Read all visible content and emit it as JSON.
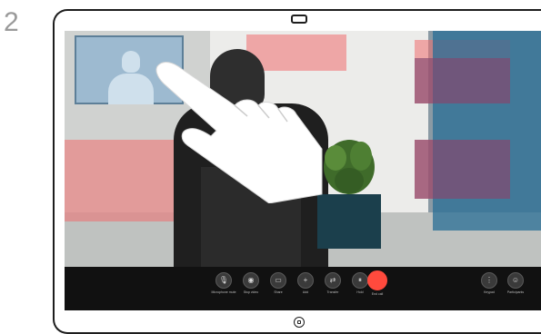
{
  "step_number": "2",
  "colors": {
    "end_call": "#ff4a3d",
    "control_bar": "#111111",
    "pip_background": "#9dbad0"
  },
  "self_view": {
    "icon": "person-silhouette-icon"
  },
  "gesture": {
    "icon": "pointing-hand-icon"
  },
  "controls": [
    {
      "id": "mute",
      "icon": "microphone-icon",
      "glyph": "🎙",
      "label": "Microphone mute"
    },
    {
      "id": "video",
      "icon": "camera-icon",
      "glyph": "◉",
      "label": "Stop video"
    },
    {
      "id": "share",
      "icon": "share-screen-icon",
      "glyph": "▭",
      "label": "Share"
    },
    {
      "id": "add",
      "icon": "plus-icon",
      "glyph": "+",
      "label": "Add"
    },
    {
      "id": "transfer",
      "icon": "transfer-icon",
      "glyph": "⇄",
      "label": "Transfer"
    },
    {
      "id": "hold",
      "icon": "pause-icon",
      "glyph": "⏸",
      "label": "Hold"
    },
    {
      "id": "end",
      "icon": "end-call-icon",
      "glyph": "",
      "label": "End call"
    },
    {
      "id": "keypad",
      "icon": "keypad-icon",
      "glyph": "⋮",
      "label": "Keypad"
    },
    {
      "id": "participants",
      "icon": "participants-icon",
      "glyph": "☺",
      "label": "Participants"
    }
  ]
}
